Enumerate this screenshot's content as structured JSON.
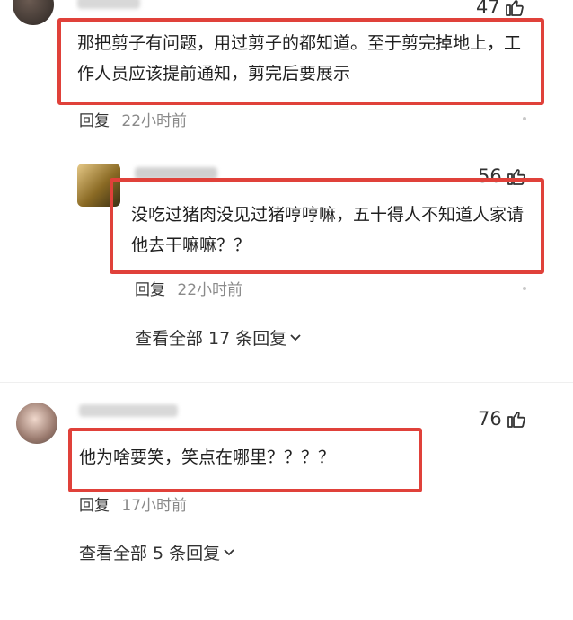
{
  "comments": [
    {
      "likes": "47",
      "text": "那把剪子有问题，用过剪子的都知道。至于剪完掉地上，工作人员应该提前通知，剪完后要展示",
      "reply_label": "回复",
      "time": "22小时前"
    },
    {
      "likes": "56",
      "text": "没吃过猪肉没见过猪哼哼嘛，五十得人不知道人家请他去干嘛嘛？？",
      "reply_label": "回复",
      "time": "22小时前"
    },
    {
      "likes": "76",
      "text": "他为啥要笑，笑点在哪里？？？？",
      "reply_label": "回复",
      "time": "17小时前"
    }
  ],
  "expand_replies": [
    {
      "label": "查看全部 17 条回复"
    },
    {
      "label": "查看全部 5 条回复"
    }
  ],
  "icons": {
    "like": "thumbs-up-icon",
    "expand": "chevron-down-icon"
  },
  "colors": {
    "highlight_border": "#e0413a",
    "muted_text": "#8a8a8a"
  }
}
